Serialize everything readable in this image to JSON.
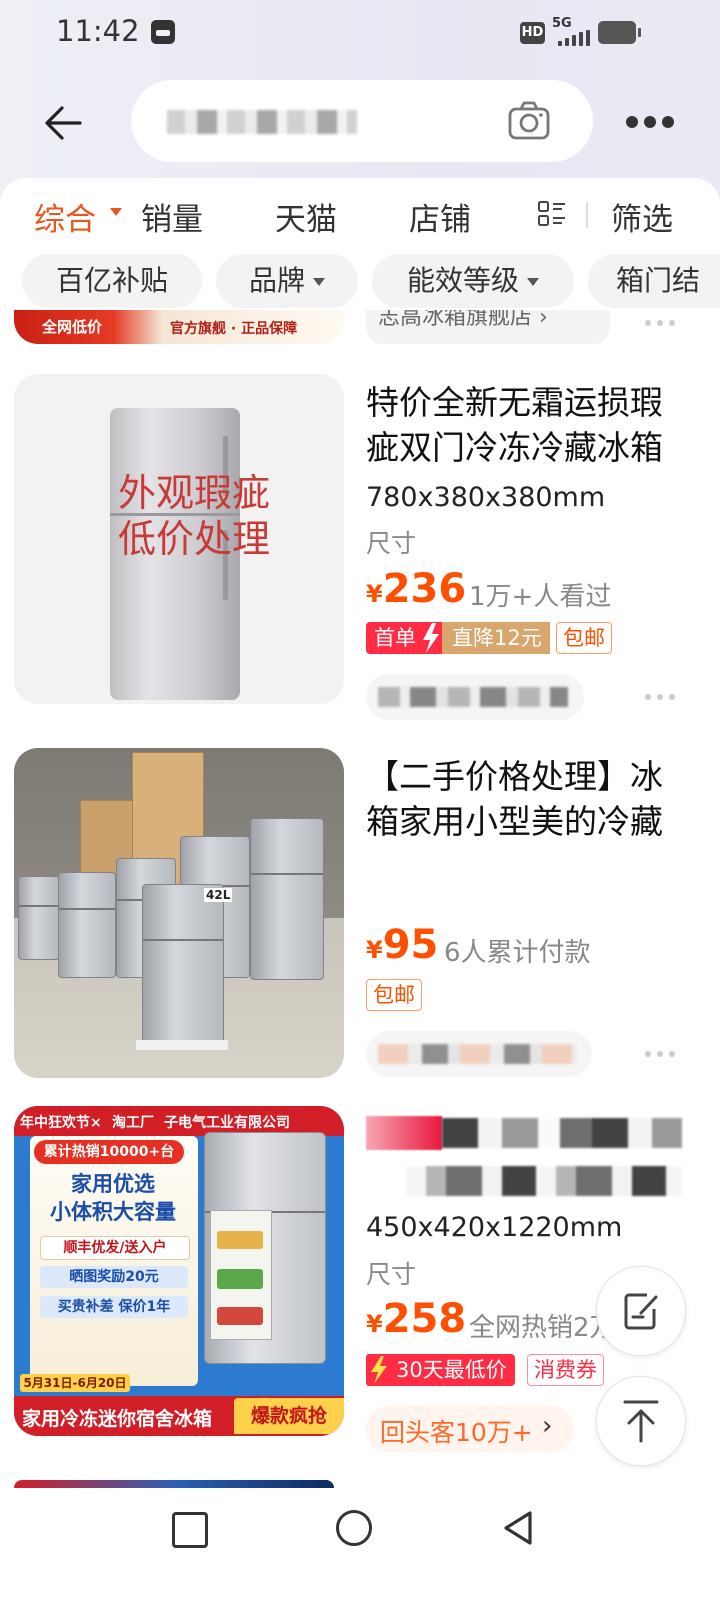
{
  "status_bar": {
    "time": "11:42",
    "hd": "HD",
    "network": "5G"
  },
  "header": {
    "search_value": "",
    "back_icon": "arrow-left-icon",
    "camera_icon": "camera-icon",
    "more_icon": "more-icon"
  },
  "sort_tabs": [
    {
      "label": "综合",
      "active": true
    },
    {
      "label": "销量"
    },
    {
      "label": "天猫"
    },
    {
      "label": "店铺"
    },
    {
      "label": "筛选"
    }
  ],
  "filter_chips": [
    {
      "label": "百亿补贴"
    },
    {
      "label": "品牌"
    },
    {
      "label": "能效等级"
    },
    {
      "label": "箱门结"
    }
  ],
  "prev_item": {
    "banner_left": "全网低价",
    "banner_right": "官方旗舰 · 正品保障",
    "store": "志高冰箱旗舰店 ›"
  },
  "products": [
    {
      "title": "特价全新无霜运损瑕疵双门冷冻冷藏冰箱",
      "image_text_1": "外观瑕疵",
      "image_text_2": "低价处理",
      "spec": "780x380x380mm",
      "spec_label": "尺寸",
      "price_symbol": "¥",
      "price": "236",
      "sales": "1万+人看过",
      "tag_first": "首单",
      "tag_discount": "直降12元",
      "tag_free": "包邮"
    },
    {
      "title": "【二手价格处理】冰箱家用小型美的冷藏",
      "image_label": "42L",
      "price_symbol": "¥",
      "price": "95",
      "sales": "6人累计付款",
      "tag_free": "包邮"
    },
    {
      "spec": "450x420x1220mm",
      "spec_label": "尺寸",
      "price_symbol": "¥",
      "price": "258",
      "sales": "全网热销2万",
      "tag_lowest": "30天最低价",
      "tag_coupon": "消费券",
      "repeat_customers": "回头客10万+",
      "image_top_1": "年中狂欢节×",
      "image_top_2": "淘工厂",
      "image_top_3": "子电气工业有限公司",
      "image_badge": "累计热销10000+台",
      "image_headline_1": "家用优选",
      "image_headline_2": "小体积大容量",
      "image_line_1": "顺丰优发/送入户",
      "image_line_2": "晒图奖励20元",
      "image_line_3": "买贵补差 保价1年",
      "image_date": "5月31日-6月20日",
      "image_bottom": "家用冷冻迷你宿舍冰箱",
      "image_hot": "爆款疯抢"
    }
  ],
  "fabs": [
    {
      "icon": "edit-note-icon"
    },
    {
      "icon": "back-to-top-icon"
    }
  ],
  "nav": {
    "recent": "square-icon",
    "home": "circle-icon",
    "back": "triangle-back-icon"
  }
}
